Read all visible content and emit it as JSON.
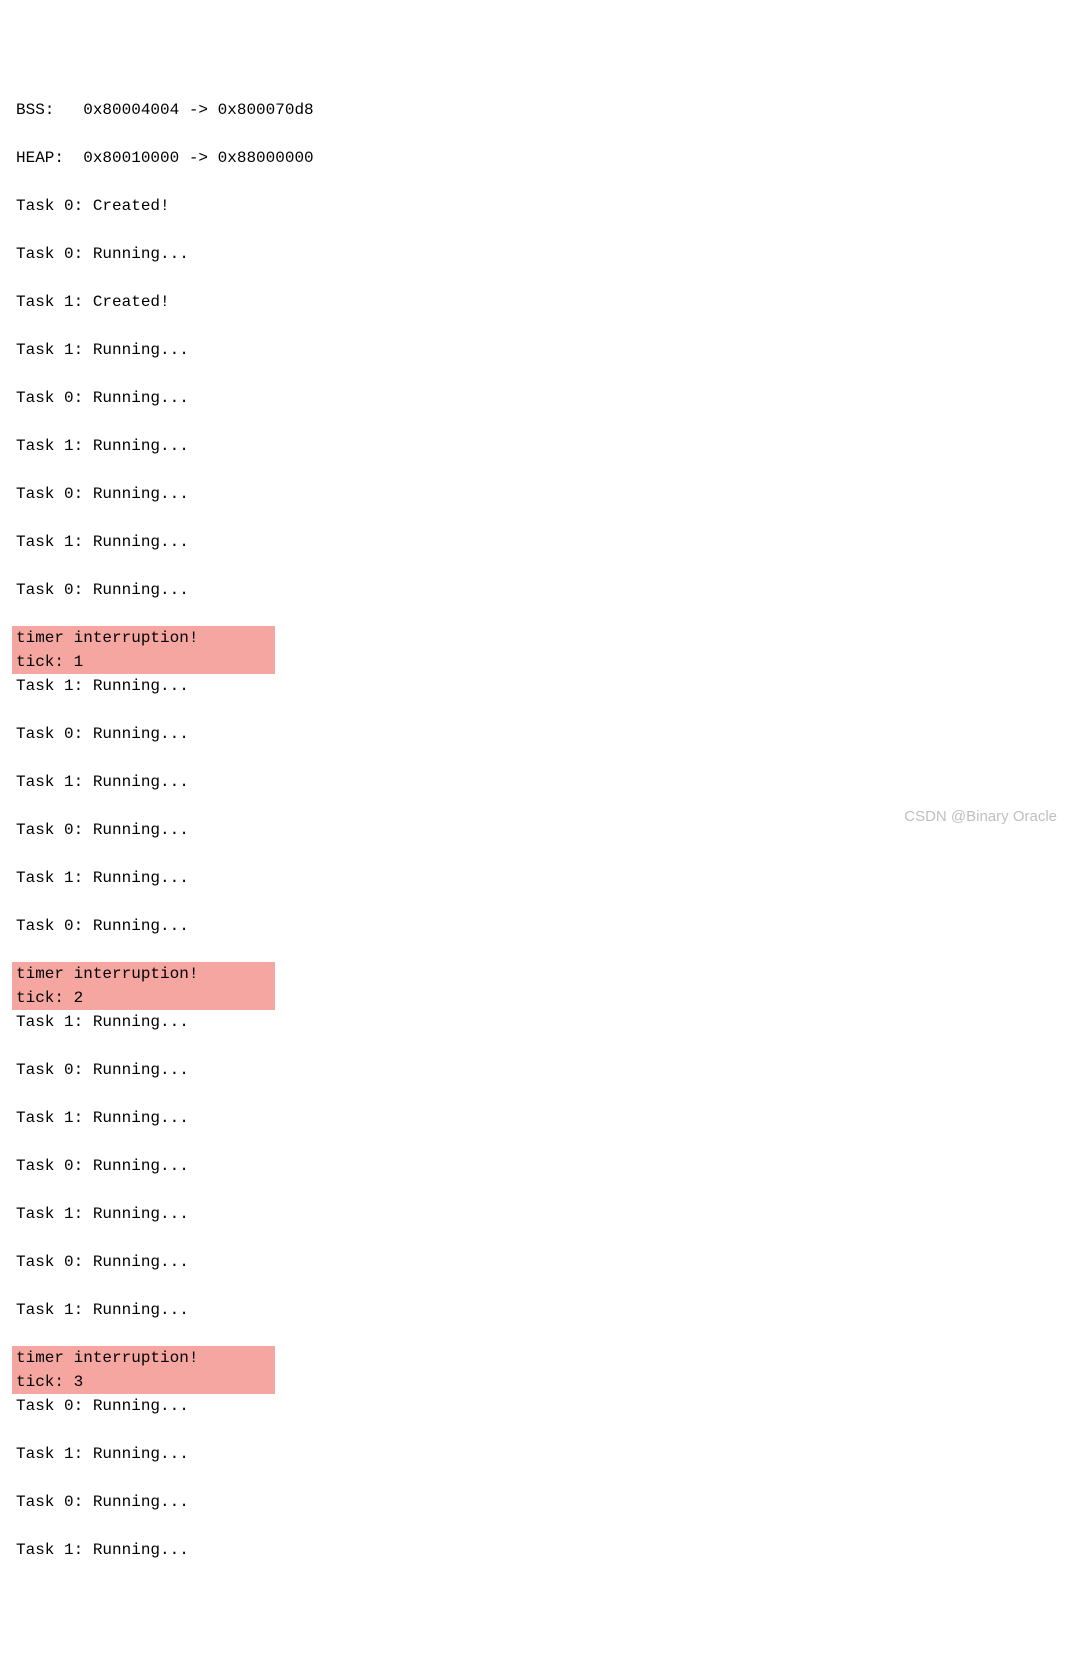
{
  "lines": [
    {
      "text": "BSS:   0x80004004 -> 0x800070d8",
      "highlight": false
    },
    {
      "text": "HEAP:  0x80010000 -> 0x88000000",
      "highlight": false
    },
    {
      "text": "Task 0: Created!",
      "highlight": false
    },
    {
      "text": "Task 0: Running...",
      "highlight": false
    },
    {
      "text": "Task 1: Created!",
      "highlight": false
    },
    {
      "text": "Task 1: Running...",
      "highlight": false
    },
    {
      "text": "Task 0: Running...",
      "highlight": false
    },
    {
      "text": "Task 1: Running...",
      "highlight": false
    },
    {
      "text": "Task 0: Running...",
      "highlight": false
    },
    {
      "text": "Task 1: Running...",
      "highlight": false
    },
    {
      "text": "Task 0: Running...",
      "highlight": false
    },
    {
      "text": "timer interruption!",
      "highlight": true
    },
    {
      "text": "tick: 1",
      "highlight": true
    },
    {
      "text": "Task 1: Running...",
      "highlight": false
    },
    {
      "text": "Task 0: Running...",
      "highlight": false
    },
    {
      "text": "Task 1: Running...",
      "highlight": false
    },
    {
      "text": "Task 0: Running...",
      "highlight": false
    },
    {
      "text": "Task 1: Running...",
      "highlight": false
    },
    {
      "text": "Task 0: Running...",
      "highlight": false
    },
    {
      "text": "timer interruption!",
      "highlight": true
    },
    {
      "text": "tick: 2",
      "highlight": true
    },
    {
      "text": "Task 1: Running...",
      "highlight": false
    },
    {
      "text": "Task 0: Running...",
      "highlight": false
    },
    {
      "text": "Task 1: Running...",
      "highlight": false
    },
    {
      "text": "Task 0: Running...",
      "highlight": false
    },
    {
      "text": "Task 1: Running...",
      "highlight": false
    },
    {
      "text": "Task 0: Running...",
      "highlight": false
    },
    {
      "text": "Task 1: Running...",
      "highlight": false
    },
    {
      "text": "timer interruption!",
      "highlight": true
    },
    {
      "text": "tick: 3",
      "highlight": true
    },
    {
      "text": "Task 0: Running...",
      "highlight": false
    },
    {
      "text": "Task 1: Running...",
      "highlight": false
    },
    {
      "text": "Task 0: Running...",
      "highlight": false
    },
    {
      "text": "Task 1: Running...",
      "highlight": false
    }
  ],
  "watermark": "CSDN @Binary Oracle"
}
